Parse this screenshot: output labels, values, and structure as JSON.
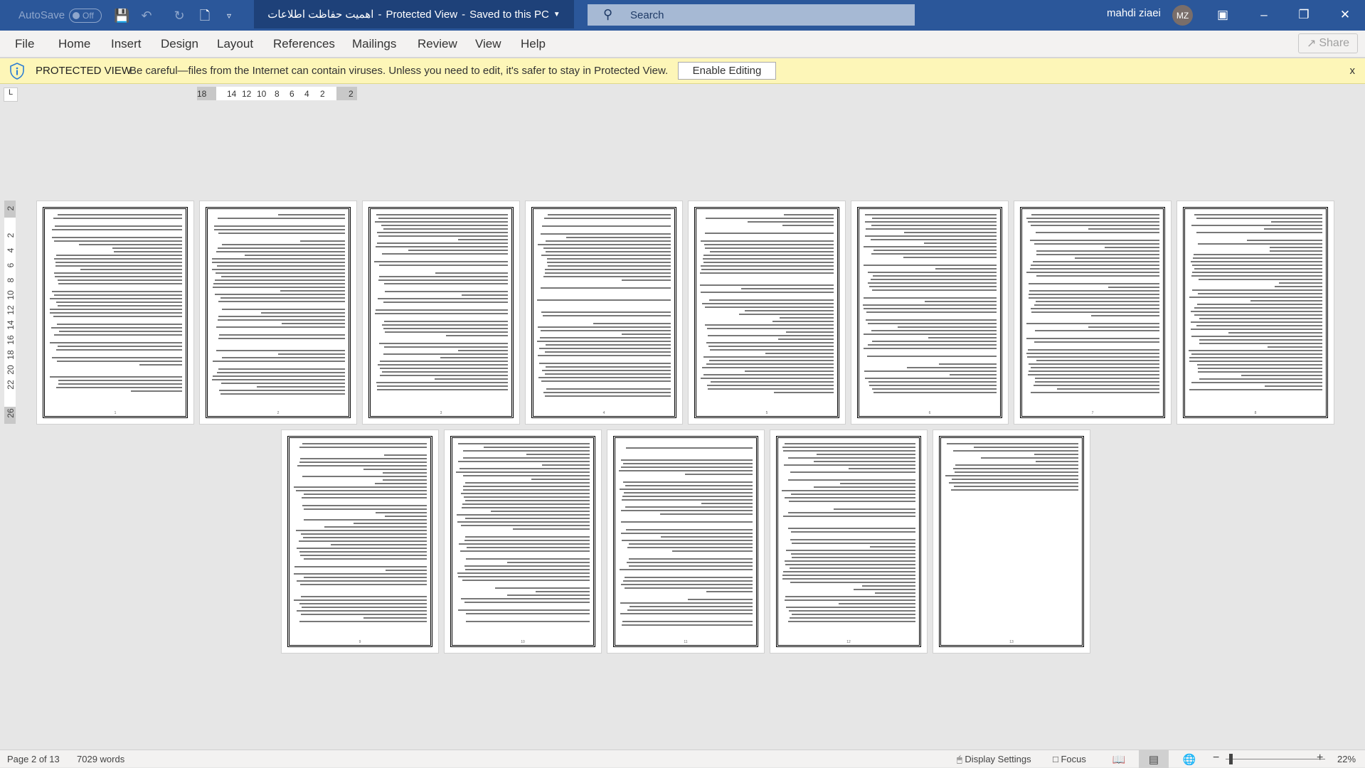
{
  "titlebar": {
    "autosave_label": "AutoSave",
    "autosave_state": "Off",
    "doc_title": "اهمیت حفاظت اطلاعات",
    "mode": "Protected View",
    "save_status": "Saved to this PC",
    "search_placeholder": "Search",
    "user_name": "mahdi ziaei",
    "user_initials": "MZ"
  },
  "menu": {
    "items": [
      "File",
      "Home",
      "Insert",
      "Design",
      "Layout",
      "References",
      "Mailings",
      "Review",
      "View",
      "Help"
    ],
    "share_label": "Share"
  },
  "protected_view": {
    "label": "PROTECTED VIEW",
    "message": "Be careful—files from the Internet can contain viruses. Unless you need to edit, it's safer to stay in Protected View.",
    "enable_button": "Enable Editing",
    "close": "x"
  },
  "ruler": {
    "horizontal": [
      "18",
      "14",
      "12",
      "10",
      "8",
      "6",
      "4",
      "2",
      "2"
    ],
    "vertical": [
      "2",
      "2",
      "4",
      "6",
      "8",
      "10",
      "12",
      "14",
      "16",
      "18",
      "20",
      "22",
      "26"
    ],
    "corner": "L"
  },
  "document": {
    "page_count": 13,
    "page_numbers": [
      "1",
      "2",
      "3",
      "4",
      "5",
      "6",
      "7",
      "8",
      "9",
      "10",
      "11",
      "12",
      "13"
    ]
  },
  "status": {
    "page": "Page 2 of 13",
    "words": "7029 words",
    "display_settings": "Display Settings",
    "focus": "Focus",
    "zoom": "22%",
    "zoom_percent": 22,
    "active_view": "print-layout"
  },
  "colors": {
    "title_bar": "#2b579a",
    "protected_bar": "#fdf6b8"
  }
}
